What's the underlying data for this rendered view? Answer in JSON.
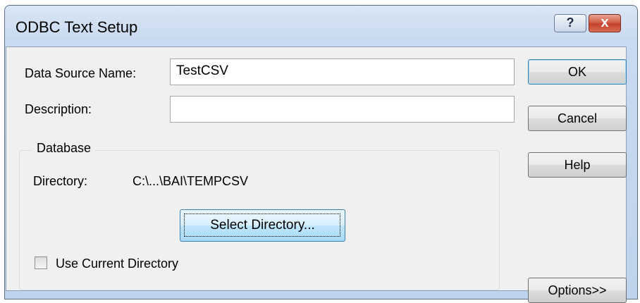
{
  "window": {
    "title": "ODBC Text Setup",
    "help_button": "?",
    "close_button": "x"
  },
  "form": {
    "dsn_label": "Data Source Name:",
    "dsn_value": "TestCSV",
    "description_label": "Description:",
    "description_value": ""
  },
  "database": {
    "group_title": "Database",
    "directory_label": "Directory:",
    "directory_value": "C:\\...\\BAI\\TEMPCSV",
    "select_directory_button": "Select Directory...",
    "use_current_directory_label": "Use Current Directory",
    "use_current_directory_checked": false
  },
  "buttons": {
    "ok": "OK",
    "cancel": "Cancel",
    "help": "Help",
    "options": "Options>>"
  }
}
